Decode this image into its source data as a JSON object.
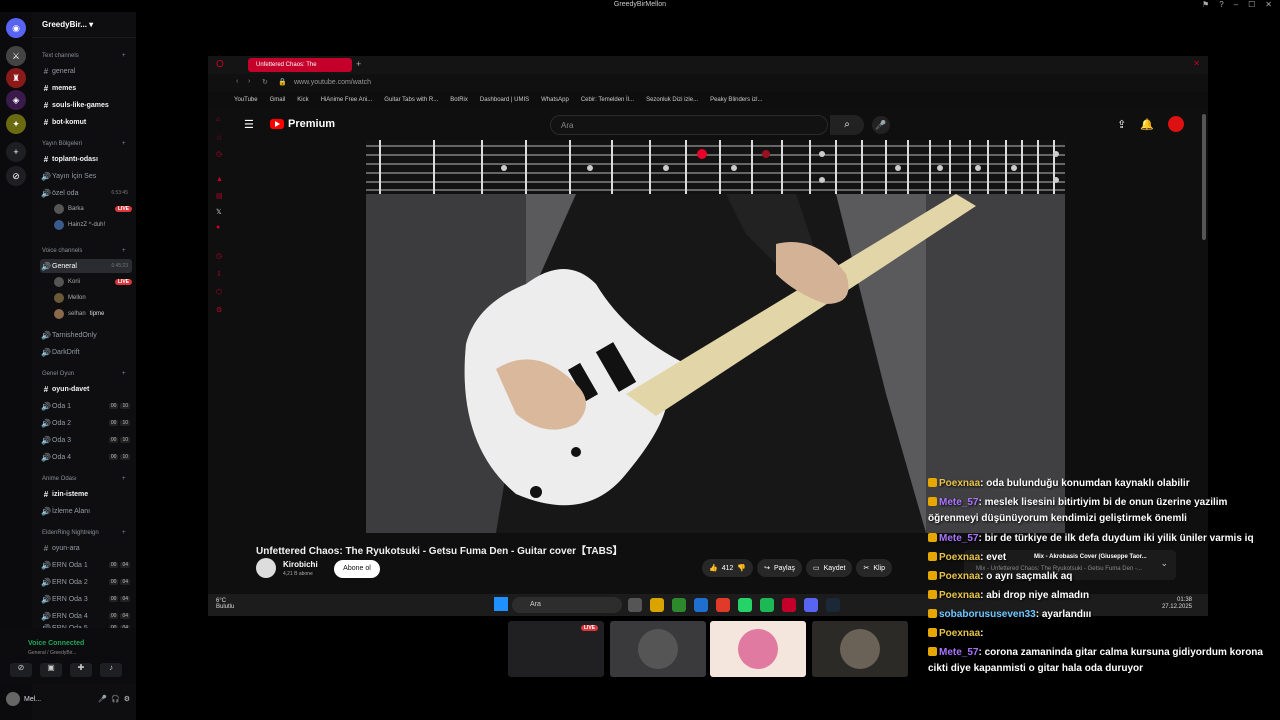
{
  "window": {
    "title": "GreedyBirMellon"
  },
  "discord": {
    "server_name": "GreedyBir...",
    "categories": {
      "text": "Text channels",
      "yayin": "Yayın Bölgeleri",
      "voice": "Voice channels",
      "genel_oyun": "Genel Oyun",
      "anime": "Anime Odası",
      "eldenring": "EldenRing Nightreign"
    },
    "text_channels": [
      "general",
      "memes",
      "souls-like-games",
      "bot-komut"
    ],
    "yayin_channels": [
      "toplantı-odası",
      "Yayın İçin Ses",
      "özel oda"
    ],
    "ozel_oda_time": "6:53:45",
    "ozel_users": [
      {
        "name": "Barka",
        "live": "LIVE"
      },
      {
        "name": "HainzZ ^-duh!"
      }
    ],
    "general_voice": {
      "name": "General",
      "time": "6:45:23"
    },
    "general_users": [
      {
        "name": "Korii",
        "live": "LIVE"
      },
      {
        "name": "Mellon"
      },
      {
        "name": "selhan",
        "extra": "tipme"
      }
    ],
    "voice_channels_extra": [
      "TarnishedOnly",
      "DarkDrift"
    ],
    "genel_oyun_channels": [
      "oyun-davet",
      "Oda 1",
      "Oda 2",
      "Oda 3",
      "Oda 4"
    ],
    "oda_counts": [
      "00",
      "10"
    ],
    "anime_channels": [
      "izin-isteme",
      "İzleme Alanı"
    ],
    "eldenring_channels": [
      "oyun-ara",
      "ERN Oda 1",
      "ERN Oda 2",
      "ERN Oda 3",
      "ERN Oda 4",
      "ERN Oda 5"
    ],
    "ern_counts": [
      "00",
      "04"
    ],
    "voice_connected": "Voice Connected",
    "voice_sub": "General / GreedyBir...",
    "username": "Mel..."
  },
  "browser": {
    "tab_title": "Unfettered Chaos: The",
    "url": "www.youtube.com/watch",
    "bookmarks": [
      "YouTube",
      "Gmail",
      "Kick",
      "HiAnime Free Ani...",
      "Guitar Tabs with R...",
      "BotRix",
      "Dashboard | UMIS",
      "WhatsApp",
      "Cebir: Temelden İl...",
      "Sezonluk Dizi izle...",
      "Peaky Blinders izl..."
    ]
  },
  "youtube": {
    "logo": "Premium",
    "search_placeholder": "Ara",
    "video_title": "Unfettered Chaos: The Ryukotsuki - Getsu Fuma Den - Guitar cover【TABS】",
    "channel": "Kirobichi",
    "subs": "4,21 B abone",
    "subscribe": "Abone ol",
    "likes": "412",
    "share": "Paylaş",
    "save": "Kaydet",
    "clip": "Klip",
    "mini_title": "Mix - Akrobasis Cover (Giuseppe Taor...",
    "mini_sub": "Mix - Unfettered Chaos: The Ryukotsuki - Getsu Fuma Den -..."
  },
  "taskbar": {
    "weather_temp": "6°C",
    "weather_desc": "Bulutlu",
    "search": "Ara",
    "time": "01:38",
    "date": "27.12.2025"
  },
  "stream": {
    "live": "LIVE"
  },
  "chat": [
    {
      "nick": "Poexnaa",
      "color": "o",
      "text": ": oda bulunduğu konumdan kaynaklı olabilir"
    },
    {
      "nick": "Mete_57",
      "color": "p",
      "text": ": meslek lisesini bitirtiyim bi de onun üzerine yazilim öğrenmeyi düşünüyorum kendimizi geliştirmek önemli"
    },
    {
      "nick": "Mete_57",
      "color": "p",
      "text": ": bir de türkiye de ilk defa duydum iki yilik üniler varmis iq"
    },
    {
      "nick": "Poexnaa",
      "color": "o",
      "text": ": evet"
    },
    {
      "nick": "Poexnaa",
      "color": "o",
      "text": ": o ayrı saçmalık aq"
    },
    {
      "nick": "Poexnaa",
      "color": "o",
      "text": ": abi drop niye almadın"
    },
    {
      "nick": "sobaborususeven33",
      "color": "c",
      "text": ": ayarlandııı"
    },
    {
      "nick": "Poexnaa",
      "color": "o",
      "text": ":"
    },
    {
      "nick": "Mete_57",
      "color": "p",
      "text": ": corona zamaninda gitar calma kursuna gidiyordum korona cikti diye kapanmisti o gitar hala oda duruyor"
    }
  ]
}
